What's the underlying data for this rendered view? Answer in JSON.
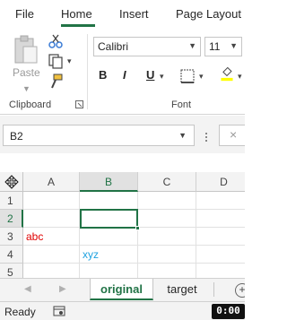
{
  "ribbon_tabs": [
    {
      "label": "File"
    },
    {
      "label": "Home",
      "active": true
    },
    {
      "label": "Insert"
    },
    {
      "label": "Page Layout"
    }
  ],
  "clipboard": {
    "paste_label": "Paste",
    "group_label": "Clipboard"
  },
  "font": {
    "family": "Calibri",
    "size": "11",
    "bold": "B",
    "italic": "I",
    "underline": "U",
    "group_label": "Font"
  },
  "formula_bar": {
    "name_box": "B2",
    "cancel_icon": "×"
  },
  "grid": {
    "columns": [
      "A",
      "B",
      "C",
      "D"
    ],
    "selected_column": "B",
    "rows": [
      "1",
      "2",
      "3",
      "4",
      "5"
    ],
    "selected_row": "2",
    "cells": {
      "A3": {
        "value": "abc",
        "color": "#e00000"
      },
      "B4": {
        "value": "xyz",
        "color": "#1fa2e0"
      }
    }
  },
  "sheets": [
    {
      "label": "original",
      "active": true
    },
    {
      "label": "target",
      "active": false
    }
  ],
  "status": {
    "ready": "Ready",
    "timer": "0:00"
  },
  "colors": {
    "accent": "#217346",
    "highlight_yellow": "#ffff00"
  }
}
